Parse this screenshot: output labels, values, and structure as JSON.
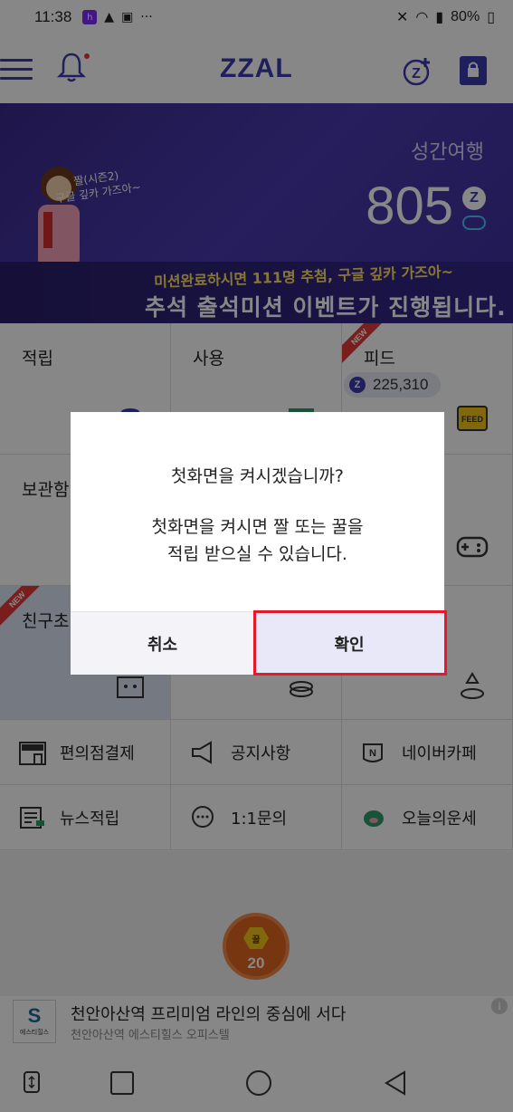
{
  "status_bar": {
    "time": "11:38",
    "battery": "80%",
    "more": "···"
  },
  "header": {
    "logo": "ZZAL"
  },
  "banner": {
    "points_label": "성간여행",
    "points": "805",
    "script": "짤(시즌2)\n구글 깊카 가즈아~",
    "line1": "미션완료하시면 111명 추첨, 구글 깊카 가즈아~",
    "line2": "추석 출석미션 이벤트가 진행됩니다."
  },
  "grid": {
    "earn": "적립",
    "use": "사용",
    "feed": "피드",
    "feed_balance": "225,310",
    "storage": "보관함",
    "friends": "친구초",
    "new_badge": "NEW"
  },
  "menu_rows": [
    {
      "label": "편의점결제"
    },
    {
      "label": "공지사항"
    },
    {
      "label": "네이버카페"
    },
    {
      "label": "뉴스적립"
    },
    {
      "label": "1:1문의"
    },
    {
      "label": "오늘의운세"
    }
  ],
  "honey": {
    "label": "꿀",
    "count": "20"
  },
  "ad": {
    "logo_text": "에스티힐스",
    "title": "천안아산역 프리미엄 라인의 중심에 서다",
    "subtitle": "천안아산역 에스티힐스 오피스텔"
  },
  "dialog": {
    "title": "첫화면을 켜시겠습니까?",
    "message_line1": "첫화면을 켜시면 짤 또는 꿀을",
    "message_line2": "적립 받으실 수 있습니다.",
    "cancel": "취소",
    "confirm": "확인"
  },
  "colors": {
    "brand": "#3b3bb0",
    "highlight": "#e8182c",
    "honey": "#e0651f"
  }
}
